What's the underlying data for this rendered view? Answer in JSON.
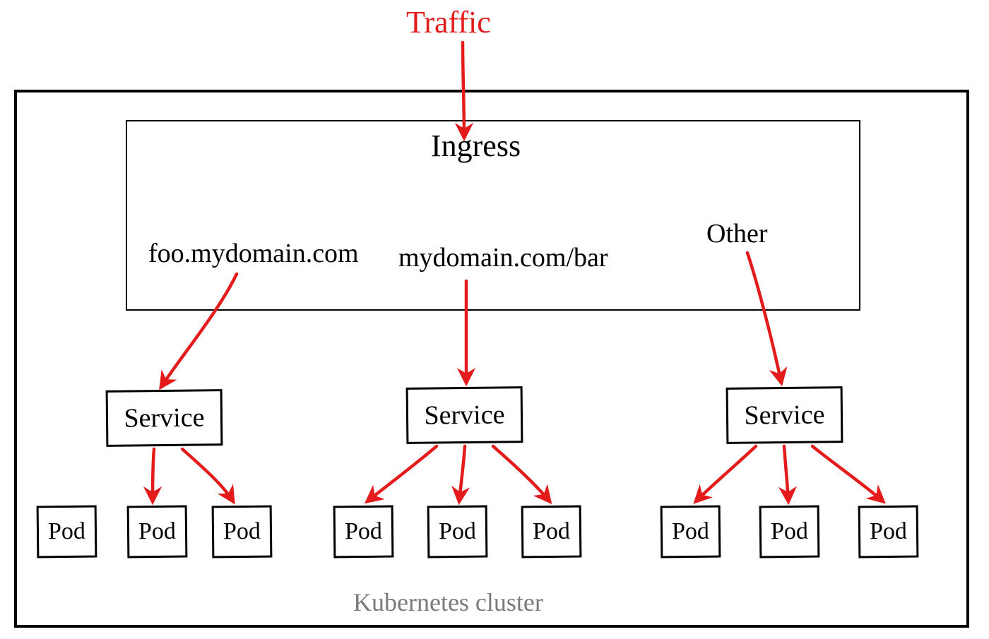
{
  "traffic_label": "Traffic",
  "cluster_label": "Kubernetes cluster",
  "ingress": {
    "title": "Ingress",
    "rules": {
      "rule1": "foo.mydomain.com",
      "rule2": "mydomain.com/bar",
      "rule3": "Other"
    }
  },
  "services": {
    "svc1_label": "Service",
    "svc2_label": "Service",
    "svc3_label": "Service"
  },
  "pods": {
    "p1": "Pod",
    "p2": "Pod",
    "p3": "Pod",
    "p4": "Pod",
    "p5": "Pod",
    "p6": "Pod",
    "p7": "Pod",
    "p8": "Pod",
    "p9": "Pod"
  }
}
